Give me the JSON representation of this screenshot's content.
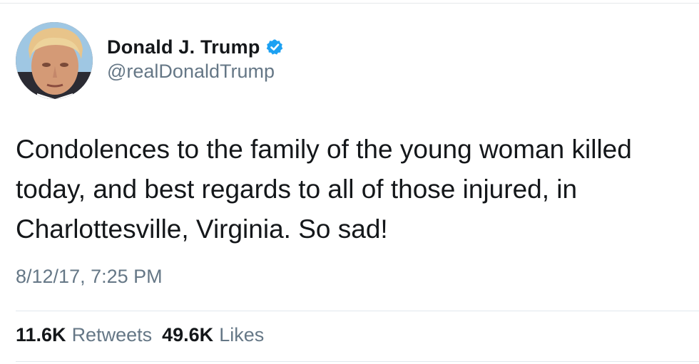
{
  "author": {
    "display_name": "Donald J. Trump",
    "handle": "@realDonaldTrump",
    "verified": true,
    "avatar_icon": "profile-photo",
    "verified_icon": "verified-badge-icon",
    "verified_color": "#1da1f2"
  },
  "tweet": {
    "text": "Condolences to the family of the young woman killed\ntoday, and best regards to all of those injured, in\nCharlottesville, Virginia. So sad!",
    "timestamp": "8/12/17, 7:25 PM"
  },
  "stats": {
    "retweets_count": "11.6K",
    "retweets_label": "Retweets",
    "likes_count": "49.6K",
    "likes_label": "Likes"
  },
  "colors": {
    "text_primary": "#14171a",
    "text_secondary": "#657786",
    "divider": "#e1e8ed"
  }
}
